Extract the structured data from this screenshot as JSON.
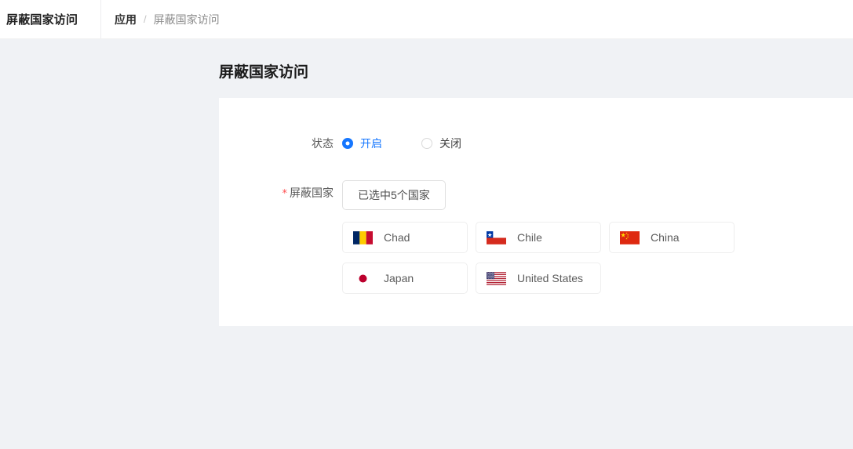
{
  "header": {
    "app_name": "屏蔽国家访问",
    "breadcrumb": {
      "root": "应用",
      "separator": "/",
      "current": "屏蔽国家访问"
    }
  },
  "page": {
    "title": "屏蔽国家访问"
  },
  "form": {
    "status": {
      "label": "状态",
      "options": [
        {
          "label": "开启",
          "value": "on",
          "selected": true
        },
        {
          "label": "关闭",
          "value": "off",
          "selected": false
        }
      ]
    },
    "blocked_countries": {
      "required_marker": "*",
      "label": "屏蔽国家",
      "select_button_label": "已选中5个国家",
      "selected_count": 5,
      "countries": [
        {
          "name": "Chad",
          "flag": "chad-flag-icon"
        },
        {
          "name": "Chile",
          "flag": "chile-flag-icon"
        },
        {
          "name": "China",
          "flag": "china-flag-icon"
        },
        {
          "name": "Japan",
          "flag": "japan-flag-icon"
        },
        {
          "name": "United States",
          "flag": "united-states-flag-icon"
        }
      ]
    }
  },
  "colors": {
    "accent": "#1677ff",
    "page_background": "#f0f2f5",
    "panel_background": "#ffffff",
    "required_marker": "#ff4d4f"
  }
}
